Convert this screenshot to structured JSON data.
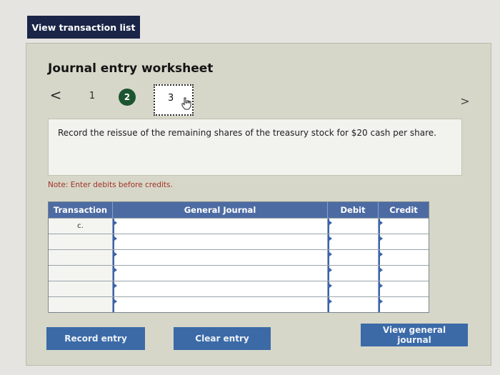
{
  "top": {
    "view_transaction_list_label": "View transaction list"
  },
  "worksheet": {
    "title": "Journal entry worksheet",
    "nav": {
      "prev_glyph": "<",
      "next_glyph": ">",
      "steps": [
        "1",
        "2",
        "3"
      ],
      "current_step": "2",
      "hover_step": "3"
    },
    "prompt": "Record the reissue of the remaining shares of the treasury stock for $20 cash per share.",
    "note": "Note: Enter debits before credits."
  },
  "table": {
    "headers": [
      "Transaction",
      "General Journal",
      "Debit",
      "Credit"
    ],
    "rows": [
      {
        "transaction": "c."
      },
      {
        "transaction": ""
      },
      {
        "transaction": ""
      },
      {
        "transaction": ""
      },
      {
        "transaction": ""
      },
      {
        "transaction": ""
      }
    ]
  },
  "buttons": {
    "record_entry": "Record entry",
    "clear_entry": "Clear entry",
    "view_general_journal": "View general journal"
  },
  "colors": {
    "primary_dark": "#1a2547",
    "button_blue": "#3b6aa7",
    "header_blue": "#4d6ba3",
    "step_active": "#1d5530",
    "note_red": "#a23224"
  },
  "icons": {
    "cursor": "hand-pointer-icon"
  }
}
